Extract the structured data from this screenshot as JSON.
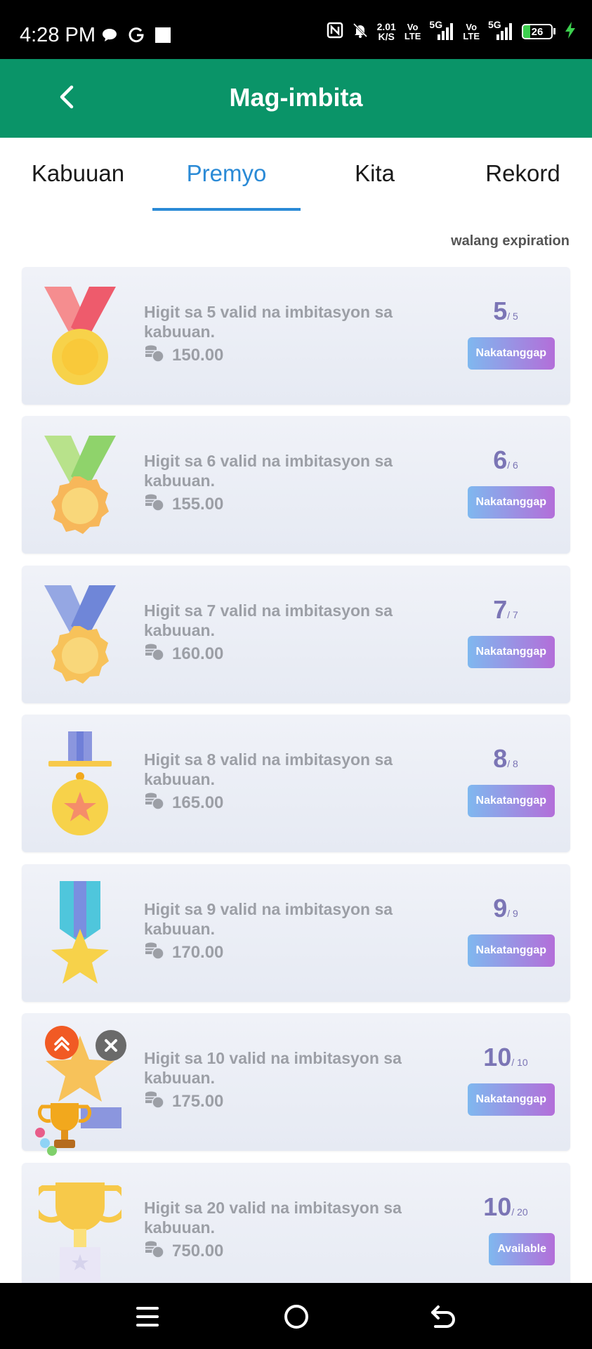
{
  "status_bar": {
    "time": "4:28 PM",
    "net_speed_value": "2.01",
    "net_speed_unit": "K/S",
    "sim1_label_top": "Vo",
    "sim1_label_bottom": "LTE",
    "sim1_network": "5G",
    "sim2_label_top": "Vo",
    "sim2_label_bottom": "LTE",
    "sim2_network": "5G",
    "battery_level": "26",
    "battery_fraction": 0.26,
    "icons": [
      "chat-bubble-icon",
      "g-app-icon",
      "square-notification-icon",
      "nfc-icon",
      "mute-bell-icon",
      "signal-icon",
      "battery-icon",
      "charging-bolt-icon"
    ]
  },
  "header": {
    "title": "Mag-imbita",
    "back_icon": "chevron-left-icon"
  },
  "tabs": [
    {
      "label": "Kabuuan",
      "active": false
    },
    {
      "label": "Premyo",
      "active": true
    },
    {
      "label": "Kita",
      "active": false
    },
    {
      "label": "Rekord",
      "active": false
    }
  ],
  "expiry_note": "walang expiration",
  "rewards": [
    {
      "description": "Higit sa 5 valid na imbitasyon sa kabuuan.",
      "amount": "150.00",
      "current": "5",
      "total": "/ 5",
      "button": "Nakatanggap",
      "medal": "red-ribbon-medal",
      "colors": {
        "ribbon": "#ee5b6c",
        "ribbon_light": "#f58d8f",
        "medal": "#f7d24a"
      }
    },
    {
      "description": "Higit sa 6 valid na imbitasyon sa kabuuan.",
      "amount": "155.00",
      "current": "6",
      "total": "/ 6",
      "button": "Nakatanggap",
      "medal": "green-ribbon-medal",
      "colors": {
        "ribbon": "#8fd36b",
        "ribbon_light": "#b8e28b",
        "medal": "#f7b75a"
      }
    },
    {
      "description": "Higit sa 7 valid na imbitasyon sa kabuuan.",
      "amount": "160.00",
      "current": "7",
      "total": "/ 7",
      "button": "Nakatanggap",
      "medal": "blue-ribbon-medal",
      "colors": {
        "ribbon": "#6f86d8",
        "ribbon_light": "#95a7e3",
        "medal": "#f7c25a"
      }
    },
    {
      "description": "Higit sa 8 valid na imbitasyon sa kabuuan.",
      "amount": "165.00",
      "current": "8",
      "total": "/ 8",
      "button": "Nakatanggap",
      "medal": "bar-star-medal",
      "colors": {
        "ribbon": "#6f7fd8",
        "ribbon_light": "#8b96de",
        "medal": "#f7d24a"
      }
    },
    {
      "description": "Higit sa 9 valid na imbitasyon sa kabuuan.",
      "amount": "170.00",
      "current": "9",
      "total": "/ 9",
      "button": "Nakatanggap",
      "medal": "star-ribbon-medal",
      "colors": {
        "ribbon": "#4fc6dc",
        "ribbon_light": "#7a8fe0",
        "medal": "#f7d24a"
      }
    },
    {
      "description": "Higit sa 10 valid na imbitasyon sa kabuuan.",
      "amount": "175.00",
      "current": "10",
      "total": "/ 10",
      "button": "Nakatanggap",
      "medal": "star-podium-medal",
      "colors": {
        "ribbon": "#f7c25a",
        "ribbon_light": "#f9d77a",
        "medal": "#f7c25a"
      }
    },
    {
      "description": "Higit sa 20 valid na imbitasyon sa kabuuan.",
      "amount": "750.00",
      "current": "10",
      "total": "/ 20",
      "button": "Available",
      "medal": "gold-trophy",
      "colors": {
        "ribbon": "#f7c94a",
        "ribbon_light": "#fbe07a",
        "medal": "#f7c94a"
      }
    }
  ],
  "floating_widget": {
    "badge_icon": "double-chevron-up-icon",
    "close_icon": "close-icon",
    "trophy_icon": "ranking-trophy-icon"
  },
  "nav_bar": {
    "icons": [
      "menu-icon",
      "home-circle-icon",
      "back-arrow-icon"
    ]
  }
}
